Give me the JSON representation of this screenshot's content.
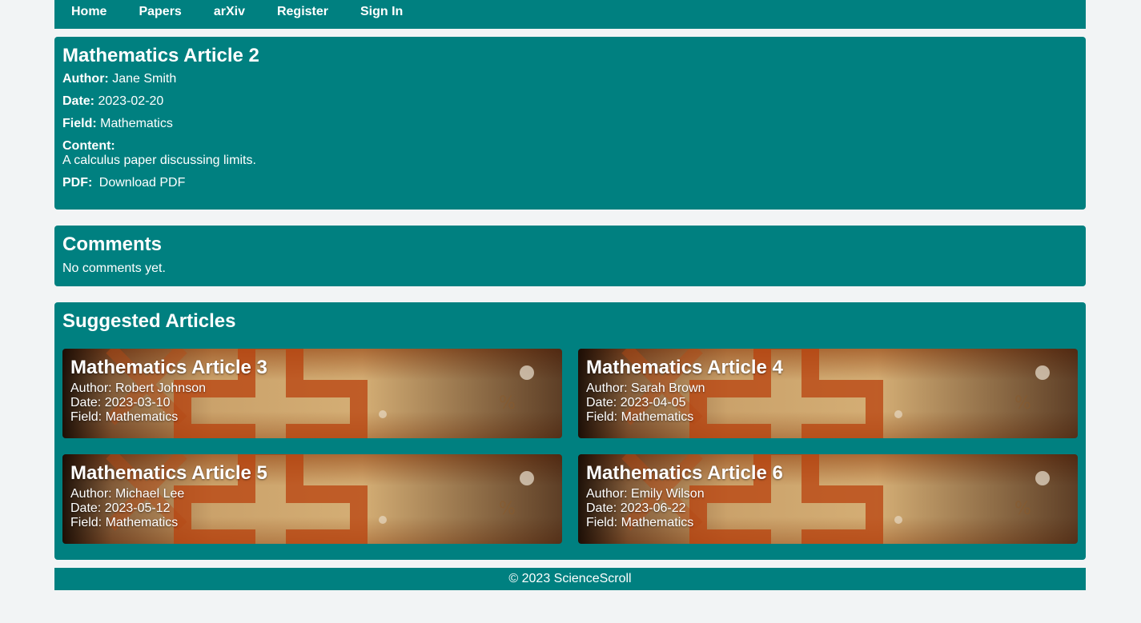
{
  "nav": {
    "items": [
      "Home",
      "Papers",
      "arXiv",
      "Register",
      "Sign In"
    ]
  },
  "article": {
    "title": "Mathematics Article 2",
    "author_label": "Author:",
    "author": "Jane Smith",
    "date_label": "Date:",
    "date": "2023-02-20",
    "field_label": "Field:",
    "field": "Mathematics",
    "content_label": "Content:",
    "content": "A calculus paper discussing limits.",
    "pdf_label": "PDF:",
    "pdf_link": "Download PDF"
  },
  "comments": {
    "title": "Comments",
    "empty_text": "No comments yet."
  },
  "suggested": {
    "title": "Suggested Articles",
    "cards": [
      {
        "title": "Mathematics Article 3",
        "author": "Author: Robert Johnson",
        "date": "Date: 2023-03-10",
        "field": "Field: Mathematics"
      },
      {
        "title": "Mathematics Article 4",
        "author": "Author: Sarah Brown",
        "date": "Date: 2023-04-05",
        "field": "Field: Mathematics"
      },
      {
        "title": "Mathematics Article 5",
        "author": "Author: Michael Lee",
        "date": "Date: 2023-05-12",
        "field": "Field: Mathematics"
      },
      {
        "title": "Mathematics Article 6",
        "author": "Author: Emily Wilson",
        "date": "Date: 2023-06-22",
        "field": "Field: Mathematics"
      }
    ]
  },
  "footer": {
    "text": "© 2023 ScienceScroll"
  },
  "colors": {
    "primary": "#008080",
    "background": "#f2f4f5"
  }
}
